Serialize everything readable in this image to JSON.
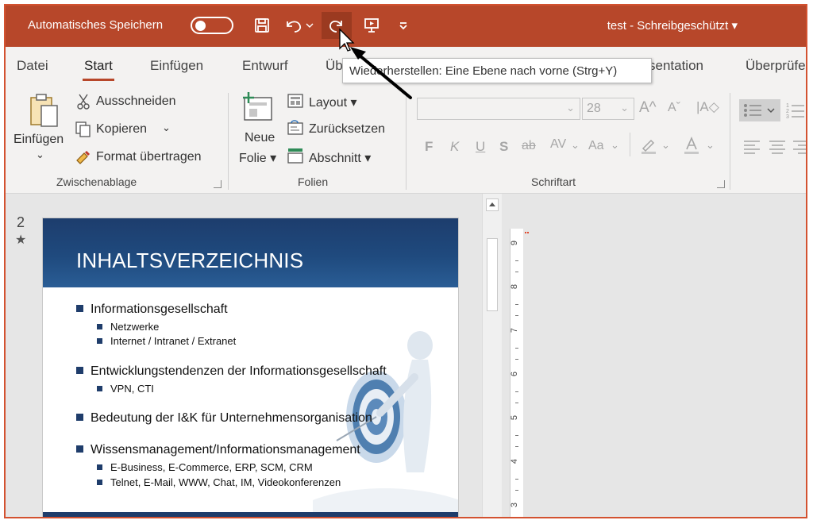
{
  "titlebar": {
    "autosave_label": "Automatisches Speichern",
    "document_title": "test  -  Schreibgeschützt  ▾",
    "background": "#b7472a"
  },
  "tabs": [
    {
      "label": "Datei"
    },
    {
      "label": "Start",
      "active": true
    },
    {
      "label": "Einfügen"
    },
    {
      "label": "Entwurf"
    },
    {
      "label": "Üb"
    },
    {
      "label": "sentation"
    },
    {
      "label": "Überprüfe"
    }
  ],
  "tooltip": {
    "text": "Wiederherstellen: Eine Ebene nach vorne (Strg+Y)"
  },
  "ribbon": {
    "clipboard": {
      "paste_label": "Einfügen",
      "cut_label": "Ausschneiden",
      "copy_label": "Kopieren",
      "format_label": "Format übertragen",
      "group_label": "Zwischenablage"
    },
    "slides": {
      "new_slide_line1": "Neue",
      "new_slide_line2": "Folie ▾",
      "layout_label": "Layout ▾",
      "reset_label": "Zurücksetzen",
      "section_label": "Abschnitt ▾",
      "group_label": "Folien"
    },
    "font": {
      "size": "28",
      "bold": "F",
      "italic": "K",
      "underline": "U",
      "shadow": "S",
      "strike": "ab",
      "spacing": "AV",
      "case": "Aa",
      "group_label": "Schriftart"
    }
  },
  "slide": {
    "number": "2",
    "star": "★",
    "title": "INHALTSVERZEICHNIS",
    "header_color": "#1f4a7e",
    "bullets": [
      {
        "text": "Informationsgesellschaft",
        "sub": [
          "Netzwerke",
          "Internet / Intranet / Extranet"
        ]
      },
      {
        "text": "Entwicklungstendenzen der Informationsgesellschaft",
        "sub": [
          "VPN, CTI"
        ]
      },
      {
        "text": "Bedeutung der I&K für Unternehmensorganisation",
        "sub": []
      },
      {
        "text": "Wissensmanagement/Informationsmanagement",
        "sub": [
          "E-Business, E-Commerce, ERP, SCM, CRM",
          "Telnet, E-Mail, WWW, Chat, IM, Videokonferenzen"
        ]
      }
    ]
  },
  "ruler": {
    "numbers": [
      "9",
      "8",
      "7",
      "6",
      "5",
      "4",
      "3"
    ]
  }
}
